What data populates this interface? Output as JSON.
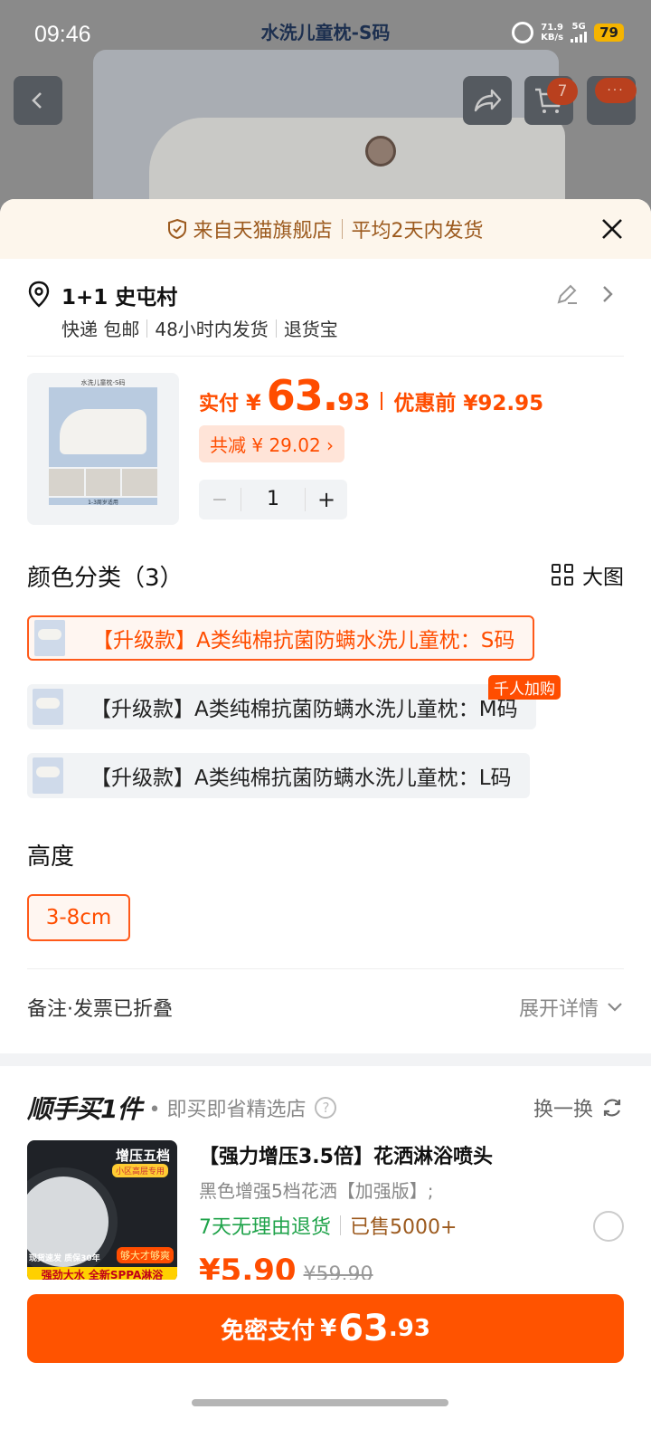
{
  "status_bar": {
    "time": "09:46",
    "page_title": "水洗儿童枕-S码",
    "net_speed_value": "71.9",
    "net_speed_unit": "KB/s",
    "network": "5G",
    "battery": "79"
  },
  "background_nav": {
    "cart_count": "7",
    "more_badge": "···"
  },
  "sheet": {
    "header_left": "来自天猫旗舰店",
    "header_right": "平均2天内发货"
  },
  "address": {
    "name": "1+1 史屯村",
    "delivery": [
      "快递 包邮",
      "48小时内发货",
      "退货宝"
    ]
  },
  "product": {
    "thumb_title": "水洗儿童枕-S码",
    "thumb_caption": "1-3周岁适用",
    "price_label": "实付",
    "currency": "¥",
    "price_int": "63.",
    "price_dec": "93",
    "before_price": "优惠前 ¥92.95",
    "discount": "共减 ¥ 29.02 ›",
    "quantity": "1",
    "minus": "−",
    "plus": "+"
  },
  "color_section": {
    "title": "颜色分类（3）",
    "big_image_label": "大图",
    "options": [
      {
        "label": "【升级款】A类纯棉抗菌防螨水洗儿童枕：S码",
        "selected": true
      },
      {
        "label": "【升级款】A类纯棉抗菌防螨水洗儿童枕：M码",
        "selected": false
      },
      {
        "label": "【升级款】A类纯棉抗菌防螨水洗儿童枕：L码",
        "selected": false
      }
    ],
    "hot_tag": "千人加购"
  },
  "height_section": {
    "title": "高度",
    "options": [
      "3-8cm"
    ]
  },
  "notes": {
    "left": "备注·发票已折叠",
    "right": "展开详情"
  },
  "addon": {
    "logo": "顺手买1件",
    "subtitle": "• 即买即省精选店",
    "swap": "换一换",
    "image_tag_1": "增压五档",
    "image_tag_2": "小区高层专用",
    "image_tag_3": "现货速发 质保30年",
    "image_tag_4": "够大才够爽",
    "image_tag_5": "强劲大水 全新SPPA淋浴",
    "title": "【强力增压3.5倍】花洒淋浴喷头",
    "spec": "黑色增强5档花洒【加强版】;",
    "return_policy": "7天无理由退货",
    "sold": "已售5000+",
    "price": "¥5.90",
    "original_price": "¥59.90"
  },
  "pay": {
    "label": "免密支付",
    "currency": "¥",
    "int": "63",
    "dec": ".93"
  },
  "colors": {
    "accent": "#ff5300",
    "price": "#ff4d00",
    "green": "#1fa34a"
  }
}
